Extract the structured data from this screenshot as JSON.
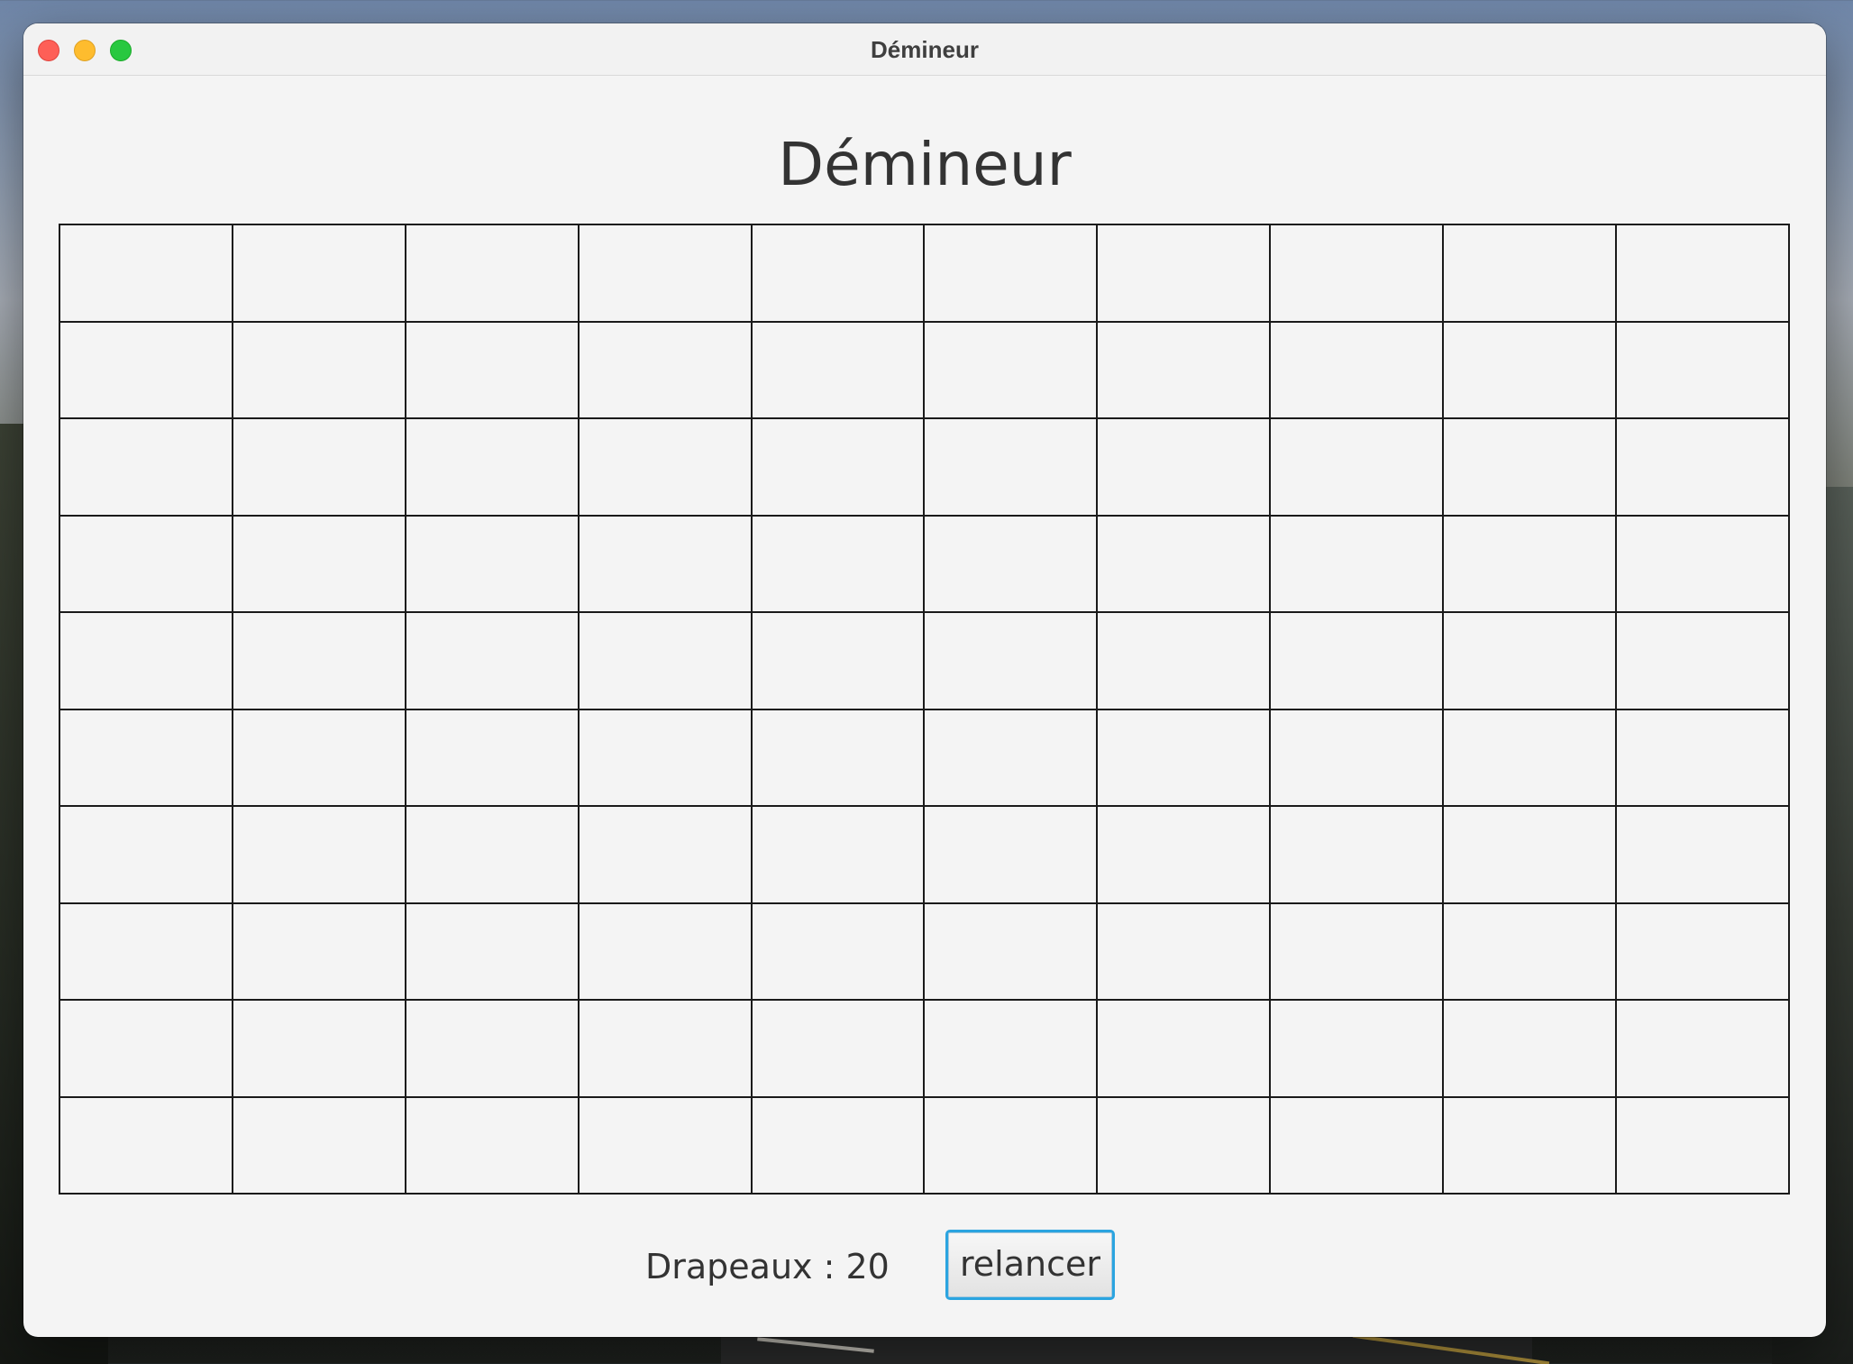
{
  "window": {
    "title": "Démineur"
  },
  "game": {
    "heading": "Démineur",
    "grid": {
      "rows": 10,
      "columns": 10
    },
    "status": {
      "flags_text": "Drapeaux : 20"
    },
    "restart_label": "relancer"
  },
  "colors": {
    "window_background": "#f4f4f4",
    "grid_lines": "#1a1a1a",
    "button_focus_ring": "#2ba4e0",
    "traffic_close": "#fe5f57",
    "traffic_minimize": "#febc2e",
    "traffic_zoom": "#28c840"
  }
}
